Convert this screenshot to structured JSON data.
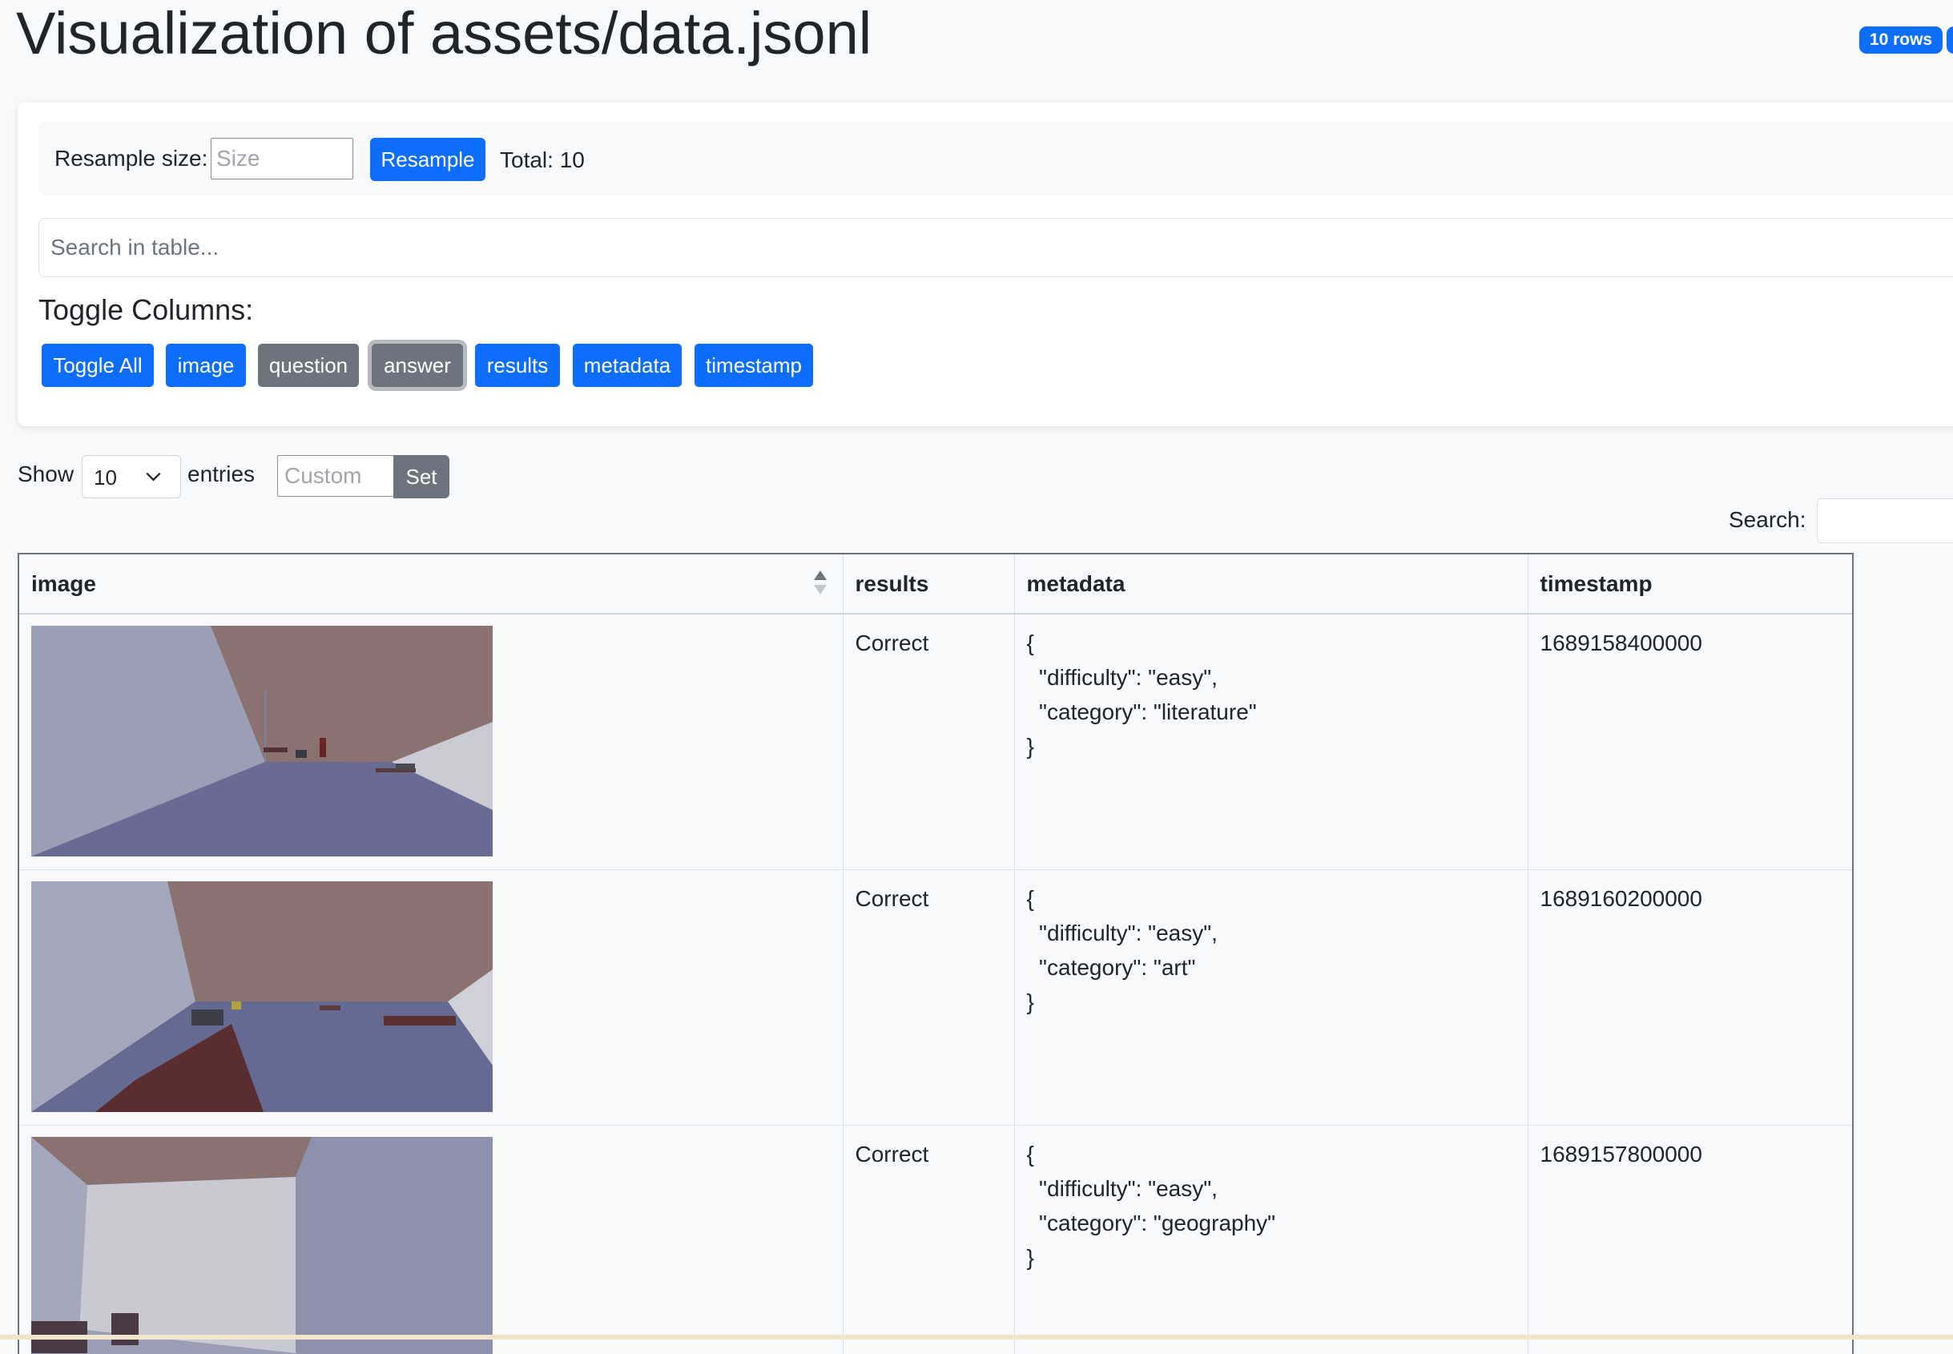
{
  "page": {
    "title": "Visualization of assets/data.jsonl",
    "rows_badge": "10 rows"
  },
  "resample": {
    "label": "Resample size:",
    "size_placeholder": "Size",
    "button_label": "Resample",
    "total_text": "Total: 10"
  },
  "table_search": {
    "placeholder": "Search in table..."
  },
  "toggle": {
    "heading": "Toggle Columns:",
    "buttons": [
      {
        "label": "Toggle All",
        "state": "on"
      },
      {
        "label": "image",
        "state": "on"
      },
      {
        "label": "question",
        "state": "off"
      },
      {
        "label": "answer",
        "state": "off"
      },
      {
        "label": "results",
        "state": "on"
      },
      {
        "label": "metadata",
        "state": "on"
      },
      {
        "label": "timestamp",
        "state": "on"
      }
    ]
  },
  "entries": {
    "show_label": "Show",
    "selected": "10",
    "entries_label": "entries",
    "custom_placeholder": "Custom",
    "set_label": "Set"
  },
  "search": {
    "label": "Search:"
  },
  "table": {
    "columns": [
      "image",
      "results",
      "metadata",
      "timestamp"
    ],
    "sort_icon": "sort-ascending-icon",
    "rows": [
      {
        "image": "room-scene-thumbnail",
        "results": "Correct",
        "metadata": "{\n  \"difficulty\": \"easy\",\n  \"category\": \"literature\"\n}",
        "timestamp": "1689158400000"
      },
      {
        "image": "room-scene-thumbnail",
        "results": "Correct",
        "metadata": "{\n  \"difficulty\": \"easy\",\n  \"category\": \"art\"\n}",
        "timestamp": "1689160200000"
      },
      {
        "image": "room-scene-thumbnail",
        "results": "Correct",
        "metadata": "{\n  \"difficulty\": \"easy\",\n  \"category\": \"geography\"\n}",
        "timestamp": "1689157800000"
      }
    ]
  },
  "colors": {
    "primary": "#0d6efd",
    "secondary": "#6c757d",
    "page_bg": "#f8f9fa",
    "text": "#212529"
  }
}
